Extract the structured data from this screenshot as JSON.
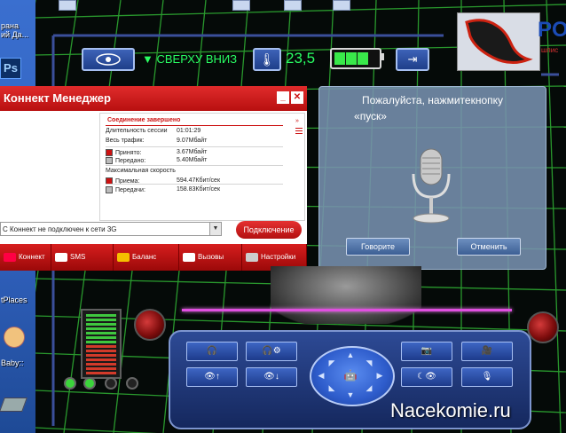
{
  "desktop": {
    "label_1": "рана",
    "label_2": "ий Да...",
    "label_3": "tPlaces",
    "label_4": "Baby::",
    "ps_icon": "Ps"
  },
  "topbar": {
    "direction": "СВЕРХУ ВНИЗ",
    "temperature": "23,5",
    "battery_level": 0.75
  },
  "logo": {
    "text": "PO",
    "sub": "шпис"
  },
  "connect_manager": {
    "title": "Коннект Менеджер",
    "status": "Соединение завершено",
    "rows": [
      {
        "label": "Длительность сессии",
        "value": "01:01:29"
      },
      {
        "label": "Весь трафик:",
        "value": "9.07Мбайт"
      },
      {
        "label": "Принято:",
        "value": "3.67Мбайт",
        "color": "#c11"
      },
      {
        "label": "Передано:",
        "value": "5.40Мбайт",
        "color": "#bbb"
      },
      {
        "label": "Максимальная скорость",
        "value": ""
      },
      {
        "label": "Приема:",
        "value": "594.47Кбит/сек",
        "color": "#c11"
      },
      {
        "label": "Передачи:",
        "value": "158.83Кбит/сек",
        "color": "#bbb"
      }
    ],
    "select_value": "С Коннект не подключен к сети 3G",
    "connect_button": "Подключение",
    "tabs": [
      "Коннект",
      "SMS",
      "Баланс",
      "Вызовы",
      "Настройки"
    ]
  },
  "speech_dialog": {
    "line1": "Пожалуйста, нажмитекнопку",
    "line2": "«пуск»",
    "speak_button": "Говорите",
    "cancel_button": "Отменить"
  },
  "watermark": "Nacekomie.ru",
  "colors": {
    "accent_green": "#29ff63",
    "accent_red": "#c11",
    "grid": "#35c83a"
  },
  "icons": [
    "eye-icon",
    "thermometer-icon",
    "battery-icon",
    "exit-icon",
    "microphone-icon",
    "headset-icon",
    "camera-icon",
    "robot-icon"
  ]
}
